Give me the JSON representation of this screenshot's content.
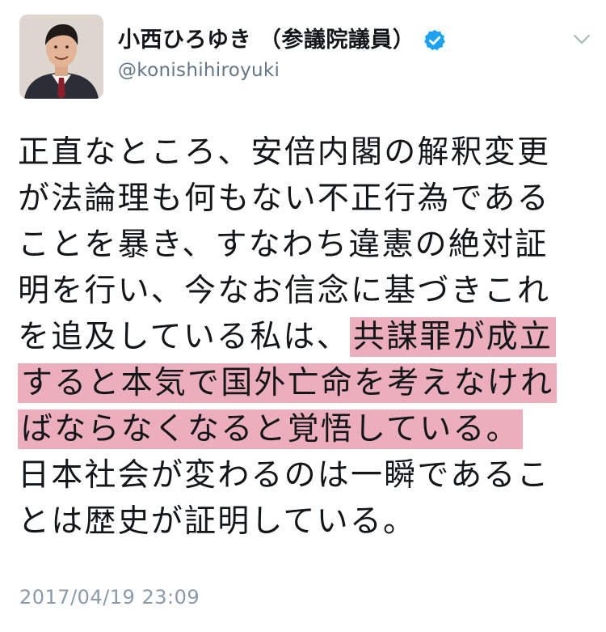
{
  "author": {
    "display_name": "小西ひろゆき （参議院議員）",
    "handle": "@konishihiroyuki",
    "verified": true
  },
  "tweet": {
    "lines": [
      {
        "before": "正直なところ、安倍内閣の解釈変更",
        "highlight": "",
        "after": ""
      },
      {
        "before": "が法論理も何もない不正行為である",
        "highlight": "",
        "after": ""
      },
      {
        "before": "ことを暴き、すなわち違憲の絶対証",
        "highlight": "",
        "after": ""
      },
      {
        "before": "明を行い、今なお信念に基づきこれ",
        "highlight": "",
        "after": ""
      },
      {
        "before": "を追及している私は、",
        "highlight": "共謀罪が成立",
        "after": ""
      },
      {
        "before": "",
        "highlight": "すると本気で国外亡命を考えなけれ",
        "after": ""
      },
      {
        "before": "",
        "highlight": "ばならなくなると覚悟している。",
        "after": ""
      },
      {
        "before": "日本社会が変わるのは一瞬であるこ",
        "highlight": "",
        "after": ""
      },
      {
        "before": "とは歴史が証明している。",
        "highlight": "",
        "after": ""
      }
    ],
    "timestamp": "2017/04/19 23:09"
  },
  "icons": {
    "verified": "verified-badge-icon",
    "more": "chevron-down-icon"
  },
  "colors": {
    "highlight": "#e28298",
    "verified_blue": "#1da1f2",
    "secondary_text": "#657786"
  }
}
